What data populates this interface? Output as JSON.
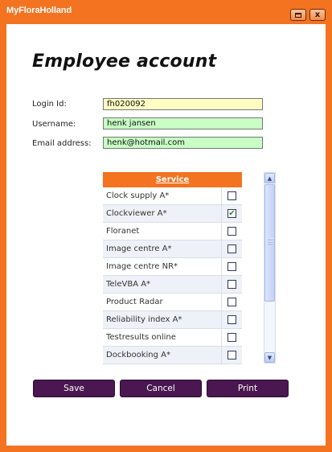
{
  "window": {
    "title": "MyFloraHolland"
  },
  "page": {
    "title": "Employee account"
  },
  "form": {
    "login_label": "Login Id:",
    "login_value": "fh020092",
    "username_label": "Username:",
    "username_value": "henk jansen",
    "email_label": "Email address:",
    "email_value": "henk@hotmail.com"
  },
  "service_table": {
    "header": "Service",
    "rows": [
      {
        "name": "Clock supply A*",
        "checked": false
      },
      {
        "name": "Clockviewer A*",
        "checked": true
      },
      {
        "name": "Floranet",
        "checked": false
      },
      {
        "name": "Image centre A*",
        "checked": false
      },
      {
        "name": "Image centre NR*",
        "checked": false
      },
      {
        "name": "TeleVBA A*",
        "checked": false
      },
      {
        "name": "Product Radar",
        "checked": false
      },
      {
        "name": "Reliability index A*",
        "checked": false
      },
      {
        "name": "Testresults online",
        "checked": false
      },
      {
        "name": "Dockbooking A*",
        "checked": false
      }
    ]
  },
  "buttons": {
    "save": "Save",
    "cancel": "Cancel",
    "print": "Print"
  },
  "colors": {
    "accent": "#f37321",
    "button": "#4a1750",
    "check": "#2a8a2a"
  }
}
